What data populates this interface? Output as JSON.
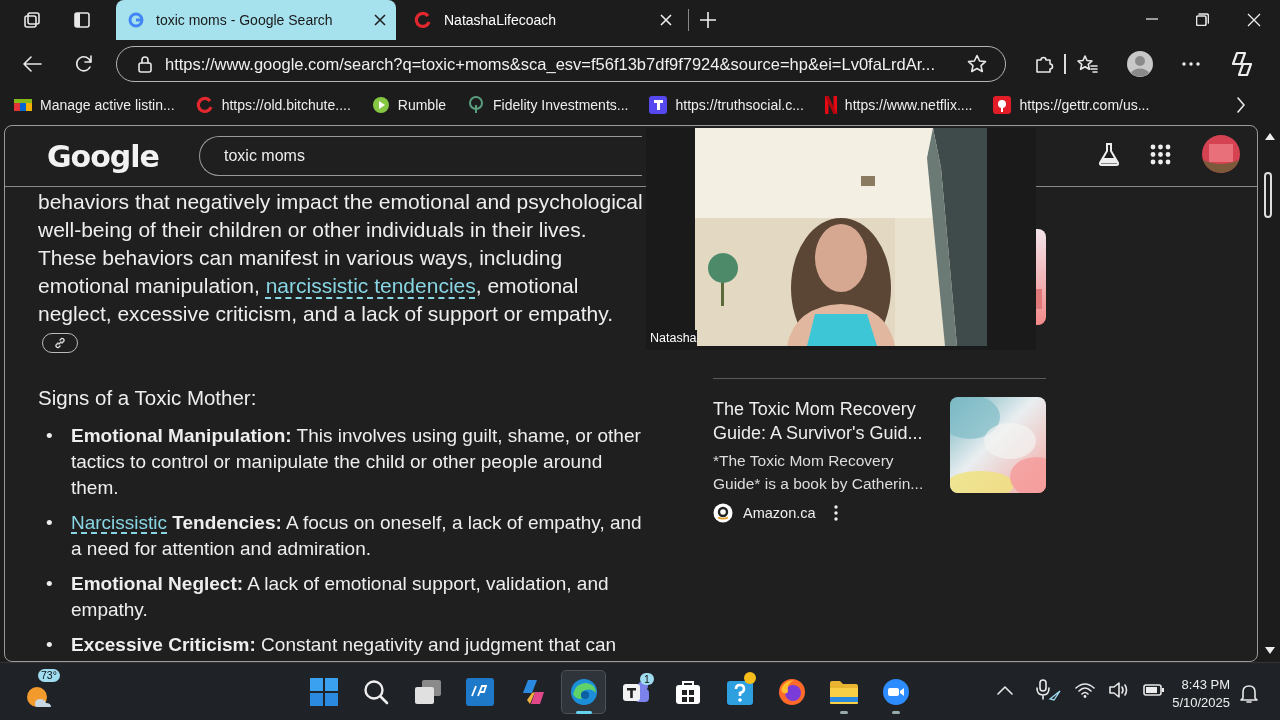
{
  "browser": {
    "tabs": [
      {
        "title": "toxic moms - Google Search",
        "selected": true,
        "kind": "google"
      },
      {
        "title": "NatashaLifecoach",
        "selected": false,
        "kind": "ring"
      }
    ],
    "address": "https://www.google.com/search?q=toxic+moms&sca_esv=f56f13b7df9f7924&source=hp&ei=Lv0faLrdAr...",
    "bookmarks": [
      {
        "label": "Manage active listin...",
        "kind": "flag"
      },
      {
        "label": "https://old.bitchute....",
        "kind": "ring"
      },
      {
        "label": "Rumble",
        "kind": "play"
      },
      {
        "label": "Fidelity Investments...",
        "kind": "tree"
      },
      {
        "label": "https://truthsocial.c...",
        "kind": "square"
      },
      {
        "label": "https://www.netflix....",
        "kind": "ribbon"
      },
      {
        "label": "https://gettr.com/us...",
        "kind": "pin"
      }
    ]
  },
  "page": {
    "logo": "Google",
    "query": "toxic moms",
    "summary": {
      "before": "behaviors that negatively impact the emotional and psychological well-being of their children or other individuals in their lives. These behaviors can manifest in various ways, including emotional manipulation, ",
      "link": "narcissistic tendencies",
      "after": ", emotional neglect, excessive criticism, and a lack of support or empathy."
    },
    "heading": "Signs of a Toxic Mother:",
    "signs": [
      {
        "bullet": "•",
        "text": "**Emotional Manipulation:** This involves using guilt, shame, or other tactics to control or manipulate the child or other people around them."
      },
      {
        "bullet": "•",
        "link": "Narcissistic",
        "text": " **Tendencies:** A focus on oneself, a lack of empathy, and a need for attention and admiration."
      },
      {
        "bullet": "•",
        "text": "**Emotional Neglect:** A lack of emotional support, validation, and empathy."
      },
      {
        "bullet": "•",
        "text": "**Excessive Criticism:** Constant negativity and judgment that can"
      }
    ],
    "result": {
      "title": "The Toxic Mom Recovery Guide: A Survivor's Guid...",
      "snippet": "*The Toxic Mom Recovery Guide* is a book by Catherin...",
      "source": "Amazon.ca"
    }
  },
  "video": {
    "name": "Natasha"
  },
  "taskbar": {
    "weather": "73°",
    "apps": [
      {
        "kind": "windows",
        "selected": false,
        "running": false
      },
      {
        "kind": "search",
        "selected": false,
        "running": false
      },
      {
        "kind": "taskview",
        "selected": false,
        "running": false
      },
      {
        "kind": "hp",
        "selected": false,
        "running": false
      },
      {
        "kind": "copilot",
        "selected": false,
        "running": false
      },
      {
        "kind": "edge",
        "selected": true,
        "running": true
      },
      {
        "kind": "teams",
        "selected": false,
        "running": false,
        "badge": "1"
      },
      {
        "kind": "store",
        "selected": false,
        "running": false
      },
      {
        "kind": "help",
        "selected": false,
        "running": false,
        "alert": true
      },
      {
        "kind": "firefox",
        "selected": false,
        "running": false
      },
      {
        "kind": "files",
        "selected": false,
        "running": true
      },
      {
        "kind": "zoom",
        "selected": false,
        "running": true
      }
    ],
    "time": "8:43 PM",
    "date": "5/10/2025"
  }
}
